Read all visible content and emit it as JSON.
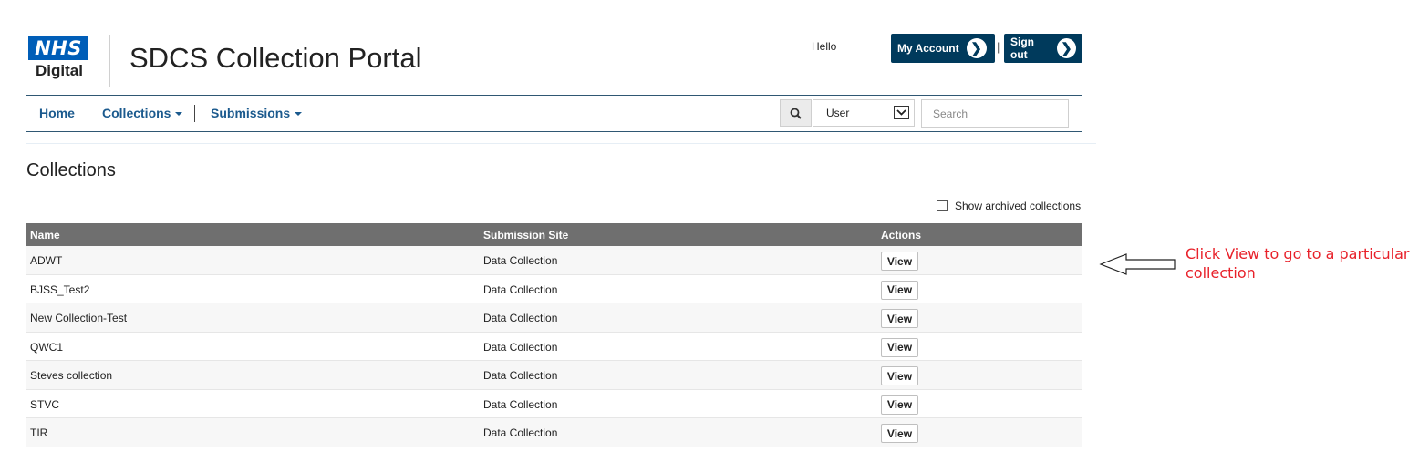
{
  "header": {
    "logo": {
      "brand": "NHS",
      "subbrand": "Digital"
    },
    "title": "SDCS Collection Portal",
    "greeting": "Hello",
    "my_account_label": "My Account",
    "sign_out_label": "Sign out",
    "separator": "|"
  },
  "nav": {
    "items": [
      {
        "label": "Home",
        "has_dropdown": false
      },
      {
        "label": "Collections",
        "has_dropdown": true
      },
      {
        "label": "Submissions",
        "has_dropdown": true
      }
    ]
  },
  "search": {
    "scope_selected": "User",
    "placeholder": "Search",
    "icon": "search-icon"
  },
  "main": {
    "heading": "Collections",
    "show_archived_label": "Show archived collections",
    "show_archived_checked": false,
    "table": {
      "columns": [
        "Name",
        "Submission Site",
        "Actions"
      ],
      "rows": [
        {
          "name": "ADWT",
          "site": "Data Collection",
          "action": "View"
        },
        {
          "name": "BJSS_Test2",
          "site": "Data Collection",
          "action": "View"
        },
        {
          "name": "New Collection-Test",
          "site": "Data Collection",
          "action": "View"
        },
        {
          "name": "QWC1",
          "site": "Data Collection",
          "action": "View"
        },
        {
          "name": "Steves collection",
          "site": "Data Collection",
          "action": "View"
        },
        {
          "name": "STVC",
          "site": "Data Collection",
          "action": "View"
        },
        {
          "name": "TIR",
          "site": "Data Collection",
          "action": "View"
        }
      ]
    }
  },
  "annotation": {
    "text": "Click View to go to a particular collection",
    "color": "#e8212a"
  },
  "colors": {
    "brand_blue": "#005eb8",
    "account_button": "#003a5c",
    "nav_link": "#1b5a8e",
    "table_header": "#6f6f6f"
  }
}
